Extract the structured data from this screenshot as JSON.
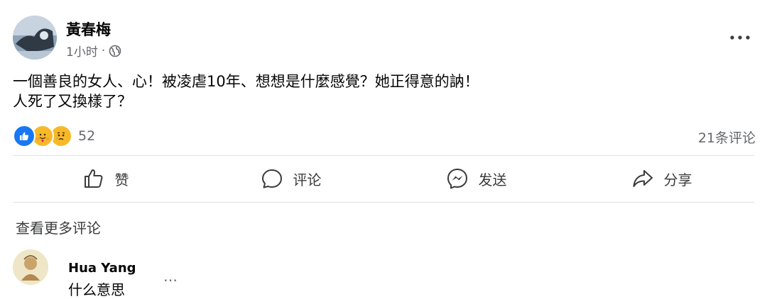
{
  "post": {
    "author": "黃春梅",
    "time": "1小时",
    "separator": "·",
    "globe_icon": "globe-icon",
    "more_icon": "more-horizontal-icon",
    "text_line1": "一個善良的女人、心！被凌虐10年、想想是什麼感覺？她正得意的訥！",
    "text_line2": "人死了又換樣了？"
  },
  "reactions": {
    "icons": [
      "like-icon",
      "care-icon",
      "sad-icon"
    ],
    "count": "52",
    "comments_count": "21条评论"
  },
  "actions": [
    {
      "label": "赞",
      "icon": "thumbs-up-icon"
    },
    {
      "label": "评论",
      "icon": "comment-icon"
    },
    {
      "label": "发送",
      "icon": "messenger-icon"
    },
    {
      "label": "分享",
      "icon": "share-icon"
    }
  ],
  "view_more_comments": "查看更多评论",
  "comment": {
    "author": "Hua Yang",
    "text": "什么意思",
    "more": "…"
  },
  "colors": {
    "like_blue": "#1877f2",
    "secondary_text": "#65676b",
    "reaction_yellow": "#f7b928"
  }
}
